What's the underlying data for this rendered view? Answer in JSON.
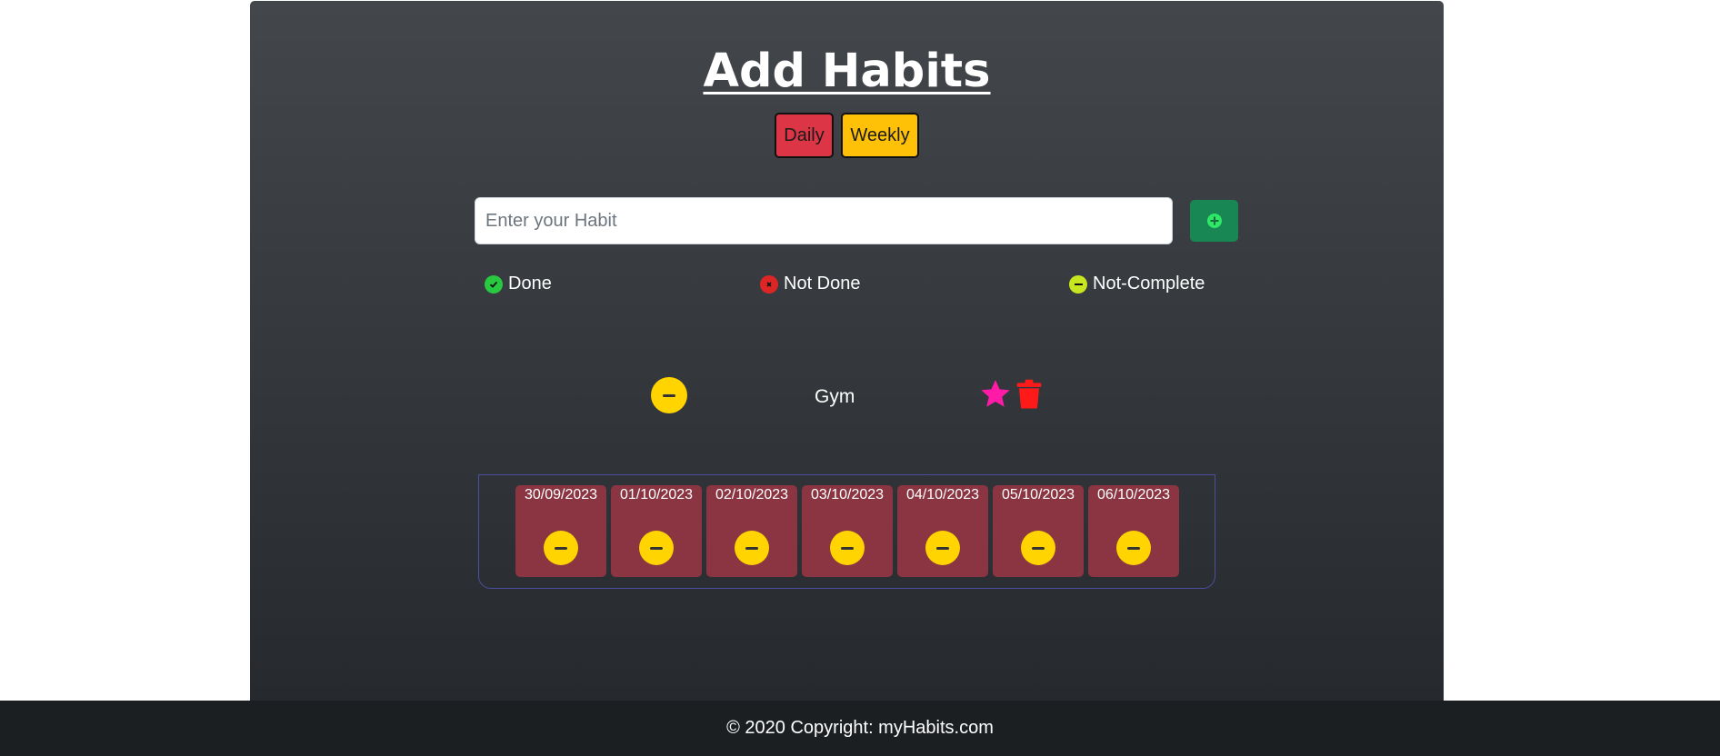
{
  "header": {
    "title": "Add Habits"
  },
  "toggles": {
    "daily": "Daily",
    "weekly": "Weekly"
  },
  "form": {
    "placeholder": "Enter your Habit"
  },
  "legend": {
    "done": "Done",
    "not_done": "Not Done",
    "not_complete": "Not-Complete"
  },
  "habit": {
    "name": "Gym",
    "status": "not-complete"
  },
  "week": {
    "dates": [
      "30/09/2023",
      "01/10/2023",
      "02/10/2023",
      "03/10/2023",
      "04/10/2023",
      "05/10/2023",
      "06/10/2023"
    ],
    "statuses": [
      "not-complete",
      "not-complete",
      "not-complete",
      "not-complete",
      "not-complete",
      "not-complete",
      "not-complete"
    ]
  },
  "footer": {
    "copyright": "© 2020 Copyright: myHabits.com"
  },
  "colors": {
    "done": "#28c840",
    "not_done": "#dc2626",
    "not_complete": "#c8e620",
    "status_yellow": "#ffd400",
    "star": "#ff1aa8",
    "trash": "#ff1a1a",
    "daily": "#dc3545",
    "weekly": "#ffc107",
    "add_button": "#198754",
    "day_card": "#8a3541"
  },
  "icons": {
    "add": "plus-circle-icon",
    "star": "star-icon",
    "trash": "trash-icon",
    "status": "minus-circle-icon"
  }
}
